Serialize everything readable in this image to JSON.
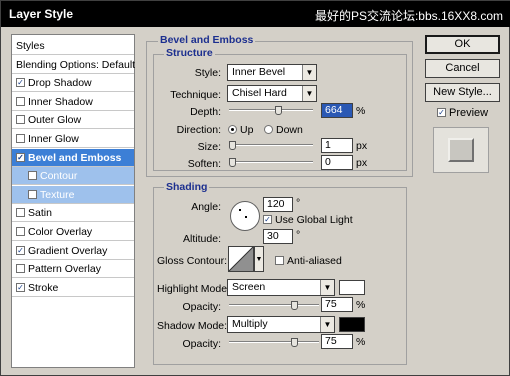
{
  "window": {
    "title": "Layer Style",
    "watermark": "最好的PS交流论坛:bbs.16XX8.com"
  },
  "styles_list": [
    {
      "label": "Styles",
      "checkbox": false,
      "checked": false,
      "state": "header"
    },
    {
      "label": "Blending Options: Default",
      "checkbox": false,
      "checked": false,
      "state": "header"
    },
    {
      "label": "Drop Shadow",
      "checkbox": true,
      "checked": true,
      "state": "normal"
    },
    {
      "label": "Inner Shadow",
      "checkbox": true,
      "checked": false,
      "state": "normal"
    },
    {
      "label": "Outer Glow",
      "checkbox": true,
      "checked": false,
      "state": "normal"
    },
    {
      "label": "Inner Glow",
      "checkbox": true,
      "checked": false,
      "state": "normal"
    },
    {
      "label": "Bevel and Emboss",
      "checkbox": true,
      "checked": true,
      "state": "selected"
    },
    {
      "label": "Contour",
      "checkbox": true,
      "checked": false,
      "state": "sub"
    },
    {
      "label": "Texture",
      "checkbox": true,
      "checked": false,
      "state": "sub"
    },
    {
      "label": "Satin",
      "checkbox": true,
      "checked": false,
      "state": "normal"
    },
    {
      "label": "Color Overlay",
      "checkbox": true,
      "checked": false,
      "state": "normal"
    },
    {
      "label": "Gradient Overlay",
      "checkbox": true,
      "checked": true,
      "state": "normal"
    },
    {
      "label": "Pattern Overlay",
      "checkbox": true,
      "checked": false,
      "state": "normal"
    },
    {
      "label": "Stroke",
      "checkbox": true,
      "checked": true,
      "state": "normal"
    }
  ],
  "buttons": {
    "ok": "OK",
    "cancel": "Cancel",
    "new_style": "New Style...",
    "preview_label": "Preview",
    "preview_checked": true
  },
  "bevel": {
    "section_title": "Bevel and Emboss",
    "structure_title": "Structure",
    "style_label": "Style:",
    "style_value": "Inner Bevel",
    "technique_label": "Technique:",
    "technique_value": "Chisel Hard",
    "depth_label": "Depth:",
    "depth_value": "664",
    "depth_unit": "%",
    "depth_level": 0.6,
    "direction_label": "Direction:",
    "direction_up": "Up",
    "direction_down": "Down",
    "direction_selected": "up",
    "size_label": "Size:",
    "size_value": "1",
    "size_unit": "px",
    "size_level": 0.0,
    "soften_label": "Soften:",
    "soften_value": "0",
    "soften_unit": "px",
    "soften_level": 0.0
  },
  "shading": {
    "title": "Shading",
    "angle_label": "Angle:",
    "angle_value": "120",
    "angle_unit": "°",
    "use_global_light_label": "Use Global Light",
    "use_global_light_checked": true,
    "altitude_label": "Altitude:",
    "altitude_value": "30",
    "altitude_unit": "°",
    "gloss_contour_label": "Gloss Contour:",
    "anti_aliased_label": "Anti-aliased",
    "anti_aliased_checked": false,
    "highlight_mode_label": "Highlight Mode:",
    "highlight_mode_value": "Screen",
    "highlight_color": "#ffffff",
    "highlight_opacity_label": "Opacity:",
    "highlight_opacity_value": "75",
    "highlight_opacity_unit": "%",
    "highlight_opacity_level": 0.75,
    "shadow_mode_label": "Shadow Mode:",
    "shadow_mode_value": "Multiply",
    "shadow_color": "#000000",
    "shadow_opacity_label": "Opacity:",
    "shadow_opacity_value": "75",
    "shadow_opacity_unit": "%",
    "shadow_opacity_level": 0.75
  },
  "colors": {
    "selected_row": "#3c7fd6",
    "group_title": "#1c2f8f"
  }
}
